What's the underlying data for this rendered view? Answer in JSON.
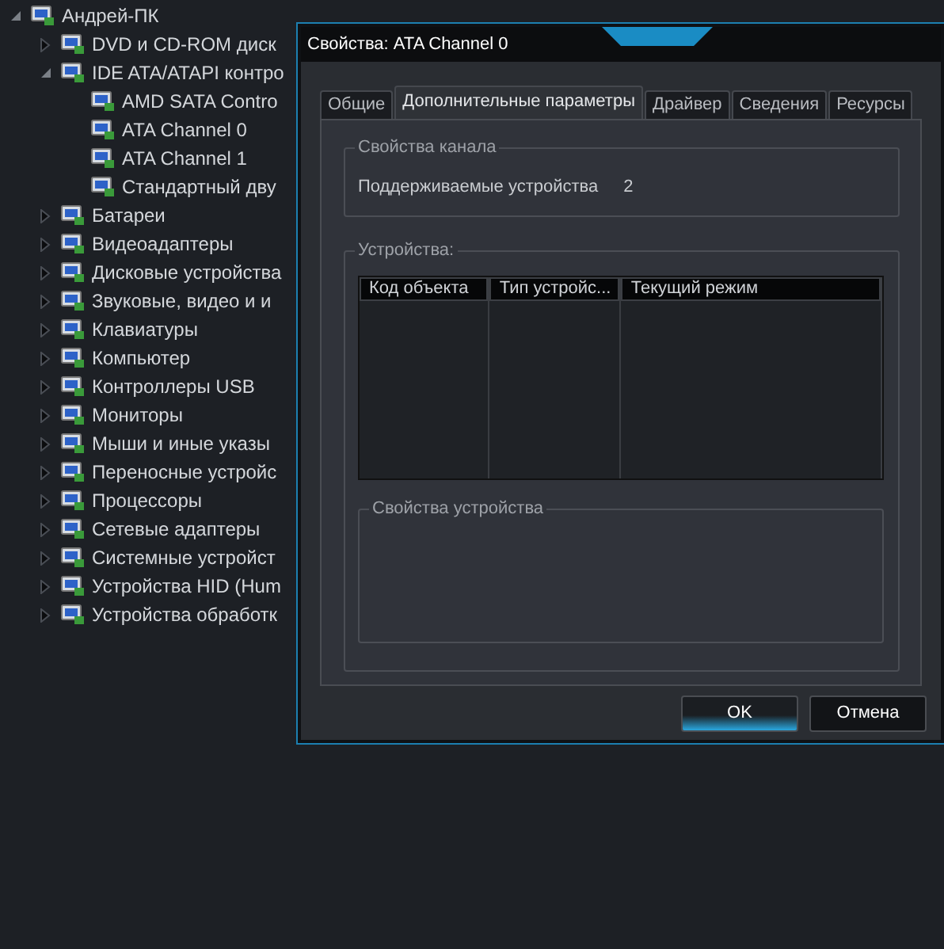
{
  "tree": [
    {
      "label": "Андрей-ПК",
      "expanded": true,
      "children": [
        {
          "label": "DVD и CD-ROM диск",
          "expanded": false
        },
        {
          "label": "IDE ATA/ATAPI контро",
          "expanded": true,
          "children": [
            {
              "label": "AMD SATA Contro"
            },
            {
              "label": "ATA Channel 0"
            },
            {
              "label": "ATA Channel 1"
            },
            {
              "label": "Стандартный дву"
            }
          ]
        },
        {
          "label": "Батареи",
          "expanded": false
        },
        {
          "label": "Видеоадаптеры",
          "expanded": false
        },
        {
          "label": "Дисковые устройства",
          "expanded": false
        },
        {
          "label": "Звуковые, видео и и",
          "expanded": false
        },
        {
          "label": "Клавиатуры",
          "expanded": false
        },
        {
          "label": "Компьютер",
          "expanded": false
        },
        {
          "label": "Контроллеры USB",
          "expanded": false
        },
        {
          "label": "Мониторы",
          "expanded": false
        },
        {
          "label": "Мыши и иные указы",
          "expanded": false
        },
        {
          "label": "Переносные устройс",
          "expanded": false
        },
        {
          "label": "Процессоры",
          "expanded": false
        },
        {
          "label": "Сетевые адаптеры",
          "expanded": false
        },
        {
          "label": "Системные устройст",
          "expanded": false
        },
        {
          "label": "Устройства HID (Hum",
          "expanded": false
        },
        {
          "label": "Устройства обработк",
          "expanded": false
        }
      ]
    }
  ],
  "dialog": {
    "title": "Свойства: ATA Channel 0",
    "tabs": [
      {
        "label": "Общие",
        "selected": false
      },
      {
        "label": "Дополнительные параметры",
        "selected": true
      },
      {
        "label": "Драйвер",
        "selected": false
      },
      {
        "label": "Сведения",
        "selected": false
      },
      {
        "label": "Ресурсы",
        "selected": false
      }
    ],
    "channel_group": {
      "title": "Свойства канала",
      "label": "Поддерживаемые устройства",
      "value": "2"
    },
    "devices_group": {
      "title": "Устройства:",
      "columns": [
        "Код объекта",
        "Тип устройс...",
        "Текущий режим"
      ]
    },
    "device_props_group": {
      "title": "Свойства устройства"
    },
    "buttons": [
      {
        "label": "OK",
        "primary": true
      },
      {
        "label": "Отмена",
        "primary": false
      }
    ]
  }
}
